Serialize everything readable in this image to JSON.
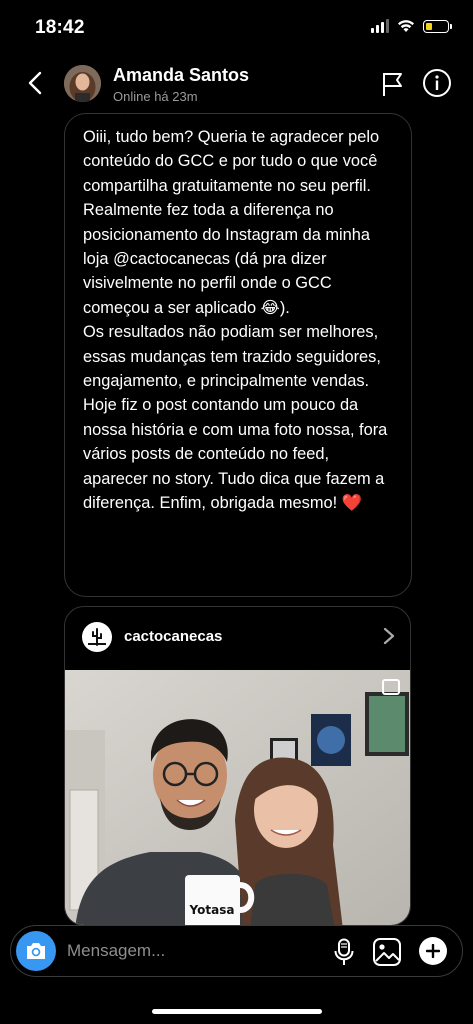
{
  "status_bar": {
    "time": "18:42",
    "battery_level": 0.25,
    "battery_color": "#f4d11b"
  },
  "header": {
    "name": "Amanda Santos",
    "presence": "Online há 23m",
    "icons": [
      "back-chevron-icon",
      "flag-icon",
      "info-icon"
    ]
  },
  "message": {
    "paragraphs": [
      "Oiii, tudo bem? Queria te agradecer pelo conteúdo do GCC e por tudo o que você compartilha gratuitamente no seu perfil. Realmente fez toda a diferença no posicionamento do Instagram da minha loja @cactocanecas (dá pra dizer visivelmente no perfil onde o GCC começou a ser aplicado 😂).",
      "Os resultados não podiam ser melhores, essas mudanças tem trazido seguidores, engajamento, e principalmente vendas.",
      "Hoje fiz o post contando um pouco da nossa história e com uma foto nossa, fora vários posts de conteúdo no feed, aparecer no story. Tudo dica que fazem a diferença. Enfim, obrigada mesmo! ❤️"
    ]
  },
  "shared_post": {
    "username": "cactocanecas",
    "mug_text": "Yotasa"
  },
  "composer": {
    "placeholder": "Mensagem...",
    "accent_color": "#3897f0"
  }
}
